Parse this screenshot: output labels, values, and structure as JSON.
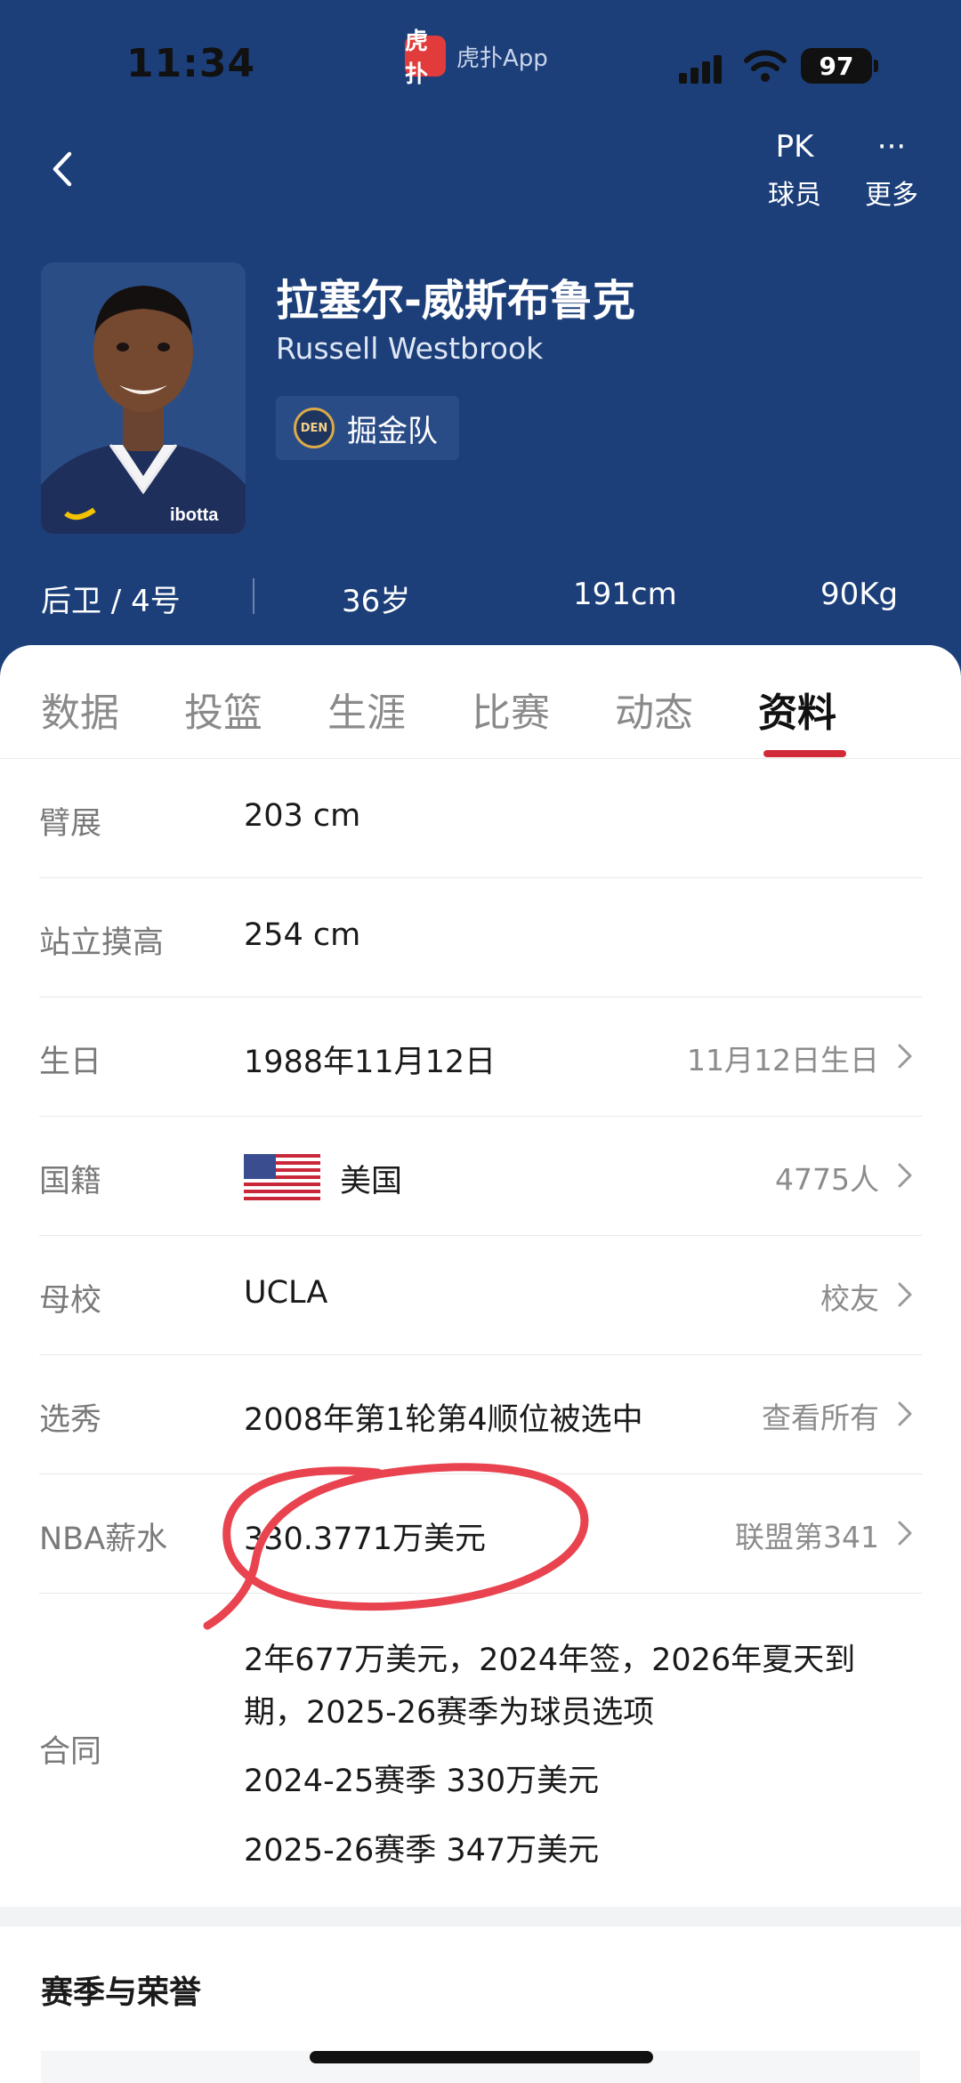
{
  "status_bar": {
    "time": "11:34",
    "app_name": "虎扑App",
    "app_logo_text": "虎扑",
    "battery": "97"
  },
  "header": {
    "pk_label": "球员",
    "pk_icon_text": "PK",
    "more_label": "更多",
    "more_icon_text": "···",
    "player_name_cn": "拉塞尔-威斯布鲁克",
    "player_name_en": "Russell Westbrook",
    "team_logo_text": "DEN",
    "team_name": "掘金队",
    "position": "后卫 / 4号",
    "age": "36岁",
    "height": "191cm",
    "weight": "90Kg",
    "avatar_jersey_text": "ibotta"
  },
  "tabs": [
    {
      "label": "数据",
      "active": false
    },
    {
      "label": "投篮",
      "active": false
    },
    {
      "label": "生涯",
      "active": false
    },
    {
      "label": "比赛",
      "active": false
    },
    {
      "label": "动态",
      "active": false
    },
    {
      "label": "资料",
      "active": true
    }
  ],
  "profile": {
    "wingspan": {
      "label": "臂展",
      "value": "203 cm"
    },
    "standing_reach": {
      "label": "站立摸高",
      "value": "254 cm"
    },
    "birthday": {
      "label": "生日",
      "value": "1988年11月12日",
      "right": "11月12日生日"
    },
    "nationality": {
      "label": "国籍",
      "value": "美国",
      "right": "4775人"
    },
    "college": {
      "label": "母校",
      "value": "UCLA",
      "right": "校友"
    },
    "draft": {
      "label": "选秀",
      "value": "2008年第1轮第4顺位被选中",
      "right": "查看所有"
    },
    "salary": {
      "label": "NBA薪水",
      "value": "330.3771万美元",
      "right": "联盟第341"
    },
    "contract": {
      "label": "合同",
      "line1": "2年677万美元，2024年签，2026年夏天到",
      "line2": "期，2025-26赛季为球员选项",
      "line3": "2024-25赛季 330万美元",
      "line4": "2025-26赛季 347万美元"
    }
  },
  "section": {
    "title": "赛季与荣誉"
  },
  "colors": {
    "header_bg": "#1c3f7a",
    "accent": "#d32a3a",
    "annotation": "#e8434f"
  }
}
